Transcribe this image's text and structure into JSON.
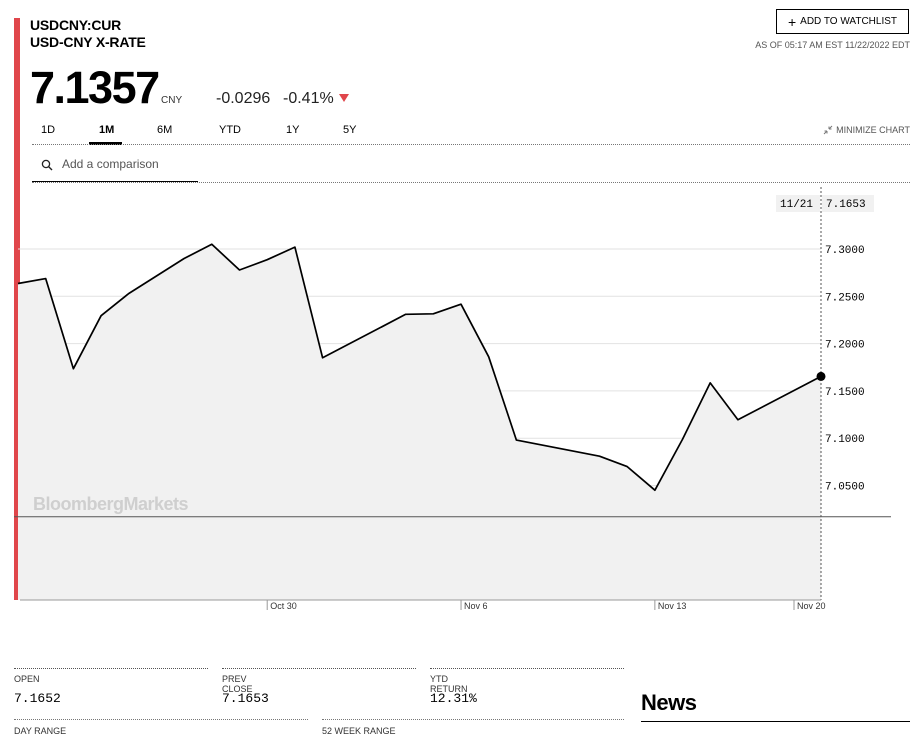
{
  "quote": {
    "ticker": "USDCNY:CUR",
    "name": "USD-CNY X-RATE",
    "price": "7.1357",
    "currency": "CNY",
    "change": "-0.0296",
    "change_pct": "-0.41%",
    "direction": "down",
    "as_of": "AS OF 05:17 AM EST 11/22/2022 EDT"
  },
  "header": {
    "watchlist_label": "ADD TO WATCHLIST"
  },
  "range_tabs": [
    "1D",
    "1M",
    "6M",
    "YTD",
    "1Y",
    "5Y"
  ],
  "active_tab": "1M",
  "minimize_label": "MINIMIZE CHART",
  "comparison": {
    "placeholder": "Add a comparison"
  },
  "watermark": "BloombergMarkets",
  "chart_data": {
    "type": "area",
    "x_labels": [
      "Oct 30",
      "Nov 6",
      "Nov 13",
      "Nov 20"
    ],
    "y_ticks": [
      "7.3000",
      "7.2500",
      "7.2000",
      "7.1500",
      "7.1000",
      "7.0500"
    ],
    "ylim": [
      6.98,
      7.36
    ],
    "baseline": 7.017,
    "crosshair": {
      "date": "11/21",
      "value": "7.1653"
    },
    "series": [
      {
        "values": [
          {
            "d": "2022-10-21",
            "v": 7.2635
          },
          {
            "d": "2022-10-22",
            "v": 7.2687
          },
          {
            "d": "2022-10-23",
            "v": 7.1735
          },
          {
            "d": "2022-10-24",
            "v": 7.2295
          },
          {
            "d": "2022-10-25",
            "v": 7.253
          },
          {
            "d": "2022-10-27",
            "v": 7.29
          },
          {
            "d": "2022-10-28",
            "v": 7.305
          },
          {
            "d": "2022-10-29",
            "v": 7.2778
          },
          {
            "d": "2022-10-30",
            "v": 7.2887
          },
          {
            "d": "2022-10-31",
            "v": 7.302
          },
          {
            "d": "2022-11-01",
            "v": 7.185
          },
          {
            "d": "2022-11-04",
            "v": 7.231
          },
          {
            "d": "2022-11-05",
            "v": 7.2315
          },
          {
            "d": "2022-11-06",
            "v": 7.2417
          },
          {
            "d": "2022-11-07",
            "v": 7.186
          },
          {
            "d": "2022-11-08",
            "v": 7.098
          },
          {
            "d": "2022-11-11",
            "v": 7.081
          },
          {
            "d": "2022-11-12",
            "v": 7.07
          },
          {
            "d": "2022-11-13",
            "v": 7.045
          },
          {
            "d": "2022-11-14",
            "v": 7.099
          },
          {
            "d": "2022-11-15",
            "v": 7.1585
          },
          {
            "d": "2022-11-16",
            "v": 7.1195
          },
          {
            "d": "2022-11-19",
            "v": 7.1653
          }
        ]
      }
    ]
  },
  "stats": {
    "open_label": "OPEN",
    "open": "7.1652",
    "prev_close_label": "PREV CLOSE",
    "prev_close": "7.1653",
    "ytd_label": "YTD RETURN",
    "ytd": "12.31%",
    "day_range_label": "DAY RANGE",
    "week52_label": "52 WEEK RANGE"
  },
  "news_title": "News"
}
